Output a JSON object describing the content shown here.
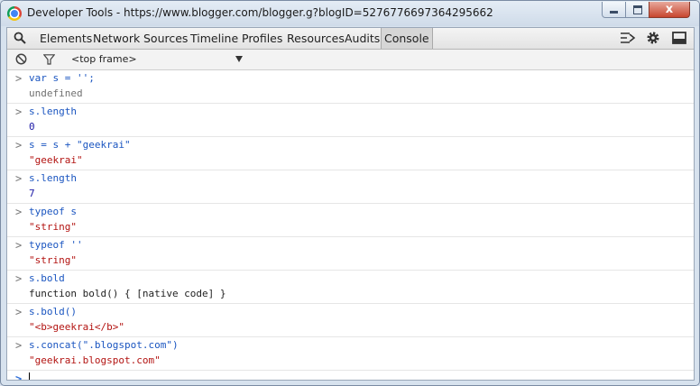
{
  "window": {
    "title": "Developer Tools - https://www.blogger.com/blogger.g?blogID=5276776697364295662",
    "close_glyph": "x"
  },
  "toolbar": {
    "tabs": [
      "Elements",
      "Network",
      "Sources",
      "Timeline",
      "Profiles",
      "Resources",
      "Audits",
      "Console"
    ],
    "active_tab": "Console"
  },
  "filterbar": {
    "frame_select": "<top frame>"
  },
  "console": {
    "entries": [
      {
        "command": "var s = '';",
        "result": "undefined",
        "result_type": "undefined"
      },
      {
        "command": "s.length",
        "result": "0",
        "result_type": "number"
      },
      {
        "command": "s = s + \"geekrai\"",
        "result": "\"geekrai\"",
        "result_type": "string"
      },
      {
        "command": "s.length",
        "result": "7",
        "result_type": "number"
      },
      {
        "command": "typeof s",
        "result": "\"string\"",
        "result_type": "string"
      },
      {
        "command": "typeof ''",
        "result": "\"string\"",
        "result_type": "string"
      },
      {
        "command": "s.bold",
        "result": "function bold() { [native code] }",
        "result_type": "plain"
      },
      {
        "command": "s.bold()",
        "result": "\"<b>geekrai</b>\"",
        "result_type": "string"
      },
      {
        "command": "s.concat(\".blogspot.com\")",
        "result": "\"geekrai.blogspot.com\"",
        "result_type": "string"
      }
    ],
    "input_value": ""
  }
}
